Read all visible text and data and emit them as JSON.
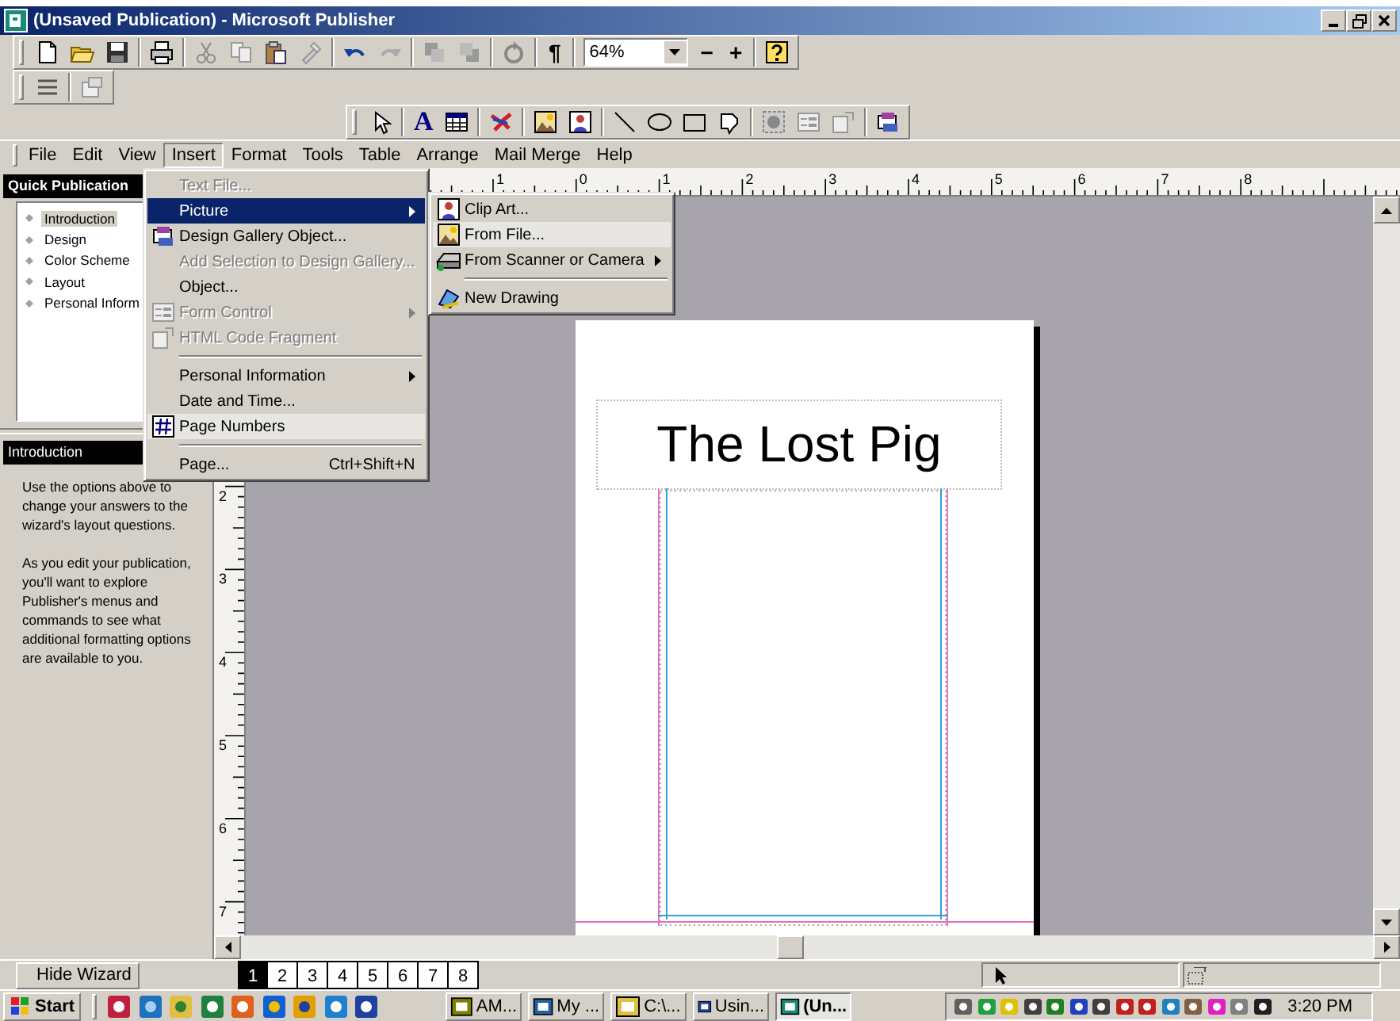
{
  "window": {
    "title": "(Unsaved Publication) - Microsoft Publisher"
  },
  "standard_toolbar": {
    "show_special": "¶",
    "zoom": "64%",
    "zoom_out": "−",
    "zoom_in": "+"
  },
  "objects_toolbar": {
    "text_tool": "A"
  },
  "menu_bar": [
    {
      "label": "File",
      "selected": false
    },
    {
      "label": "Edit",
      "selected": false
    },
    {
      "label": "View",
      "selected": false
    },
    {
      "label": "Insert",
      "selected": true
    },
    {
      "label": "Format",
      "selected": false
    },
    {
      "label": "Tools",
      "selected": false
    },
    {
      "label": "Table",
      "selected": false
    },
    {
      "label": "Arrange",
      "selected": false
    },
    {
      "label": "Mail Merge",
      "selected": false
    },
    {
      "label": "Help",
      "selected": false
    }
  ],
  "insert_menu": [
    {
      "kind": "item",
      "label": "Text File...",
      "disabled": true,
      "selected": false,
      "hovered": false,
      "submenu": false
    },
    {
      "kind": "item",
      "label": "Picture",
      "disabled": false,
      "selected": true,
      "hovered": false,
      "submenu": true
    },
    {
      "kind": "item",
      "label": "Design Gallery Object...",
      "disabled": false,
      "selected": false,
      "hovered": false,
      "submenu": false
    },
    {
      "kind": "item",
      "label": "Add Selection to Design Gallery...",
      "disabled": true,
      "selected": false,
      "hovered": false,
      "submenu": false
    },
    {
      "kind": "item",
      "label": "Object...",
      "disabled": false,
      "selected": false,
      "hovered": false,
      "submenu": false
    },
    {
      "kind": "item",
      "label": "Form Control",
      "disabled": true,
      "selected": false,
      "hovered": false,
      "submenu": true
    },
    {
      "kind": "item",
      "label": "HTML Code Fragment",
      "disabled": true,
      "selected": false,
      "hovered": false,
      "submenu": false
    },
    {
      "kind": "separator"
    },
    {
      "kind": "item",
      "label": "Personal Information",
      "disabled": false,
      "selected": false,
      "hovered": false,
      "submenu": true
    },
    {
      "kind": "item",
      "label": "Date and Time...",
      "disabled": false,
      "selected": false,
      "hovered": false,
      "submenu": false
    },
    {
      "kind": "item",
      "label": "Page Numbers",
      "disabled": false,
      "selected": false,
      "hovered": true,
      "submenu": false
    },
    {
      "kind": "separator"
    },
    {
      "kind": "item",
      "label": "Page...",
      "shortcut": "Ctrl+Shift+N",
      "disabled": false,
      "selected": false,
      "hovered": false,
      "submenu": false
    }
  ],
  "picture_submenu": [
    {
      "kind": "item",
      "label": "Clip Art...",
      "disabled": false,
      "selected": false,
      "hovered": false,
      "submenu": false
    },
    {
      "kind": "item",
      "label": "From File...",
      "disabled": false,
      "selected": false,
      "hovered": true,
      "submenu": false
    },
    {
      "kind": "item",
      "label": "From Scanner or Camera",
      "disabled": false,
      "selected": false,
      "hovered": false,
      "submenu": true
    },
    {
      "kind": "separator"
    },
    {
      "kind": "item",
      "label": "New Drawing",
      "disabled": false,
      "selected": false,
      "hovered": false,
      "submenu": false
    }
  ],
  "wizard": {
    "title": "Quick Publication",
    "items": [
      {
        "label": "Introduction",
        "selected": true
      },
      {
        "label": "Design",
        "selected": false
      },
      {
        "label": "Color Scheme",
        "selected": false
      },
      {
        "label": "Layout",
        "selected": false
      },
      {
        "label": "Personal Inform",
        "selected": false
      }
    ],
    "section_title": "Introduction",
    "paragraphs": [
      "Use the options above to change your answers to the wizard's layout questions.",
      "As you edit your publication, you'll want to explore Publisher's menus and commands to see what additional formatting options are available to you."
    ]
  },
  "rulers": {
    "horizontal": [
      "1",
      "0",
      "1",
      "2",
      "3",
      "4",
      "5",
      "6",
      "7",
      "8"
    ],
    "vertical": [
      "2",
      "3",
      "4",
      "5",
      "6",
      "7"
    ]
  },
  "publication": {
    "title": "The Lost Pig"
  },
  "hide_wizard_button": "Hide Wizard",
  "pages": [
    {
      "label": "1",
      "selected": true
    },
    {
      "label": "2",
      "selected": false
    },
    {
      "label": "3",
      "selected": false
    },
    {
      "label": "4",
      "selected": false
    },
    {
      "label": "5",
      "selected": false
    },
    {
      "label": "6",
      "selected": false
    },
    {
      "label": "7",
      "selected": false
    },
    {
      "label": "8",
      "selected": false
    }
  ],
  "taskbar": {
    "start": "Start",
    "tasks": [
      {
        "label": "AM...",
        "selected": false
      },
      {
        "label": "My ...",
        "selected": false
      },
      {
        "label": "C:\\...",
        "selected": false
      },
      {
        "label": "Usin...",
        "selected": false
      },
      {
        "label": "(Un...",
        "selected": true
      }
    ],
    "clock": "3:20 PM"
  }
}
